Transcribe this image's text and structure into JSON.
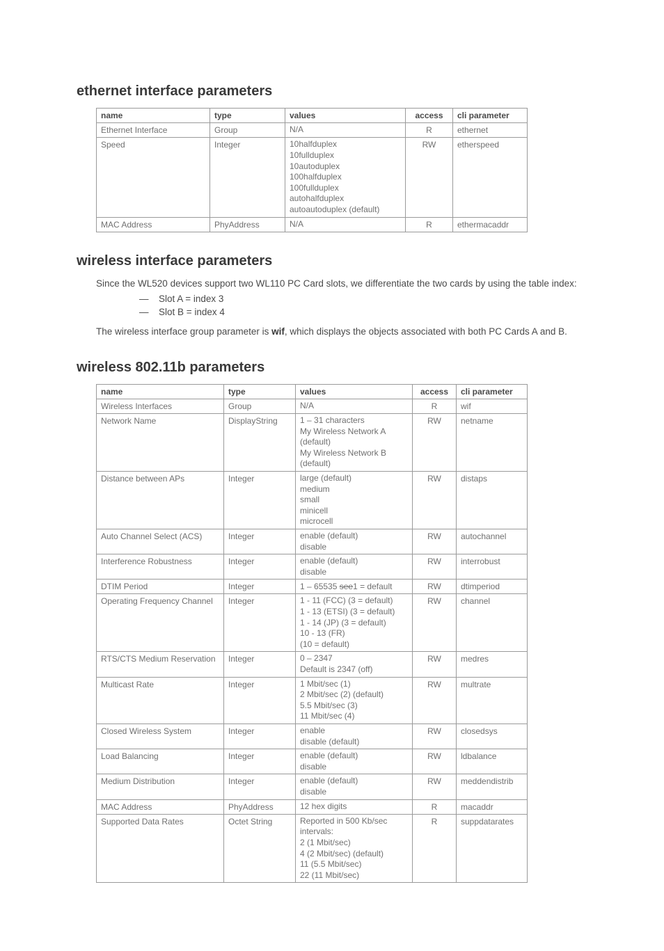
{
  "sections": {
    "ethernet": {
      "heading": "ethernet interface parameters",
      "cols": [
        "name",
        "type",
        "values",
        "access",
        "cli parameter"
      ],
      "rows": [
        {
          "name": "Ethernet Interface",
          "type": "Group",
          "values": [
            "N/A"
          ],
          "access": "R",
          "cli": "ethernet"
        },
        {
          "name": "Speed",
          "type": "Integer",
          "values": [
            "10halfduplex",
            "10fullduplex",
            "10autoduplex",
            "100halfduplex",
            "100fullduplex",
            "autohalfduplex",
            "autoautoduplex (default)"
          ],
          "access": "RW",
          "cli": "etherspeed"
        },
        {
          "name": "MAC Address",
          "type": "PhyAddress",
          "values": [
            "N/A"
          ],
          "access": "R",
          "cli": "ethermacaddr"
        }
      ]
    },
    "wireless_intro": {
      "heading": "wireless interface parameters",
      "p1": "Since the WL520 devices support two WL110 PC Card slots, we differentiate the two cards by using the table index:",
      "bullets": [
        "Slot A = index 3",
        "Slot B = index 4"
      ],
      "p2_pre": "The wireless interface group parameter is ",
      "p2_bold": "wif",
      "p2_post": ", which displays the objects associated with both PC Cards A and B."
    },
    "w80211b": {
      "heading": "wireless 802.11b parameters",
      "cols": [
        "name",
        "type",
        "values",
        "access",
        "cli parameter"
      ],
      "rows": [
        {
          "name": "Wireless Interfaces",
          "type": "Group",
          "values": [
            "N/A"
          ],
          "access": "R",
          "cli": "wif"
        },
        {
          "name": "Network Name",
          "type": "DisplayString",
          "values": [
            "1 – 31 characters",
            "My Wireless Network A (default)",
            "My Wireless Network B (default)"
          ],
          "access": "RW",
          "cli": "netname"
        },
        {
          "name": "Distance between APs",
          "type": "Integer",
          "values": [
            "large (default)",
            "medium",
            "small",
            "minicell",
            "microcell"
          ],
          "access": "RW",
          "cli": "distaps"
        },
        {
          "name": "Auto Channel Select (ACS)",
          "type": "Integer",
          "values": [
            "enable (default)",
            "disable"
          ],
          "access": "RW",
          "cli": "autochannel"
        },
        {
          "name": "Interference Robustness",
          "type": "Integer",
          "values": [
            "enable (default)",
            "disable"
          ],
          "access": "RW",
          "cli": "interrobust"
        },
        {
          "name": "DTIM Period",
          "type": "Integer",
          "values_html": "1 – 65535 <span class=\"strike\">see</span>1 = default",
          "access": "RW",
          "cli": "dtimperiod"
        },
        {
          "name": "Operating Frequency Channel",
          "type": "Integer",
          "values": [
            "1 - 11 (FCC) (3 = default)",
            "1 - 13 (ETSI) (3 = default)",
            "1 - 14 (JP) (3 = default)",
            "10 - 13 (FR)",
            "(10 = default)"
          ],
          "access": "RW",
          "cli": "channel"
        },
        {
          "name": "RTS/CTS Medium Reservation",
          "type": "Integer",
          "values": [
            "0 – 2347",
            "Default is 2347 (off)"
          ],
          "access": "RW",
          "cli": "medres"
        },
        {
          "name": "Multicast Rate",
          "type": "Integer",
          "values": [
            "1 Mbit/sec (1)",
            "2 Mbit/sec (2) (default)",
            "5.5 Mbit/sec (3)",
            "11 Mbit/sec (4)"
          ],
          "access": "RW",
          "cli": "multrate"
        },
        {
          "name": "Closed Wireless System",
          "type": "Integer",
          "values": [
            "enable",
            "disable (default)"
          ],
          "access": "RW",
          "cli": "closedsys"
        },
        {
          "name": "Load Balancing",
          "type": "Integer",
          "values": [
            "enable (default)",
            "disable"
          ],
          "access": "RW",
          "cli": "ldbalance"
        },
        {
          "name": "Medium Distribution",
          "type": "Integer",
          "values": [
            "enable (default)",
            "disable"
          ],
          "access": "RW",
          "cli": "meddendistrib"
        },
        {
          "name": "MAC Address",
          "type": "PhyAddress",
          "values": [
            "12 hex digits"
          ],
          "access": "R",
          "cli": "macaddr"
        },
        {
          "name": "Supported Data Rates",
          "type": "Octet String",
          "values": [
            "Reported in 500 Kb/sec intervals:",
            "2 (1 Mbit/sec)",
            "4 (2 Mbit/sec) (default)",
            "11 (5.5 Mbit/sec)",
            "22 (11 Mbit/sec)"
          ],
          "access": "R",
          "cli": "suppdatarates"
        }
      ]
    }
  },
  "chart_data": {
    "type": "table",
    "tables": [
      {
        "title": "ethernet interface parameters",
        "columns": [
          "name",
          "type",
          "values",
          "access",
          "cli parameter"
        ],
        "rows": [
          [
            "Ethernet Interface",
            "Group",
            "N/A",
            "R",
            "ethernet"
          ],
          [
            "Speed",
            "Integer",
            "10halfduplex; 10fullduplex; 10autoduplex; 100halfduplex; 100fullduplex; autohalfduplex; autoautoduplex (default)",
            "RW",
            "etherspeed"
          ],
          [
            "MAC Address",
            "PhyAddress",
            "N/A",
            "R",
            "ethermacaddr"
          ]
        ]
      },
      {
        "title": "wireless 802.11b parameters",
        "columns": [
          "name",
          "type",
          "values",
          "access",
          "cli parameter"
        ],
        "rows": [
          [
            "Wireless Interfaces",
            "Group",
            "N/A",
            "R",
            "wif"
          ],
          [
            "Network Name",
            "DisplayString",
            "1 – 31 characters; My Wireless Network A (default); My Wireless Network B (default)",
            "RW",
            "netname"
          ],
          [
            "Distance between APs",
            "Integer",
            "large (default); medium; small; minicell; microcell",
            "RW",
            "distaps"
          ],
          [
            "Auto Channel Select (ACS)",
            "Integer",
            "enable (default); disable",
            "RW",
            "autochannel"
          ],
          [
            "Interference Robustness",
            "Integer",
            "enable (default); disable",
            "RW",
            "interrobust"
          ],
          [
            "DTIM Period",
            "Integer",
            "1 – 65535 see 1 = default",
            "RW",
            "dtimperiod"
          ],
          [
            "Operating Frequency Channel",
            "Integer",
            "1 - 11 (FCC) (3 = default); 1 - 13 (ETSI) (3 = default); 1 - 14 (JP) (3 = default); 10 - 13 (FR); (10 = default)",
            "RW",
            "channel"
          ],
          [
            "RTS/CTS Medium Reservation",
            "Integer",
            "0 – 2347; Default is 2347 (off)",
            "RW",
            "medres"
          ],
          [
            "Multicast Rate",
            "Integer",
            "1 Mbit/sec (1); 2 Mbit/sec (2) (default); 5.5 Mbit/sec (3); 11 Mbit/sec (4)",
            "RW",
            "multrate"
          ],
          [
            "Closed Wireless System",
            "Integer",
            "enable; disable (default)",
            "RW",
            "closedsys"
          ],
          [
            "Load Balancing",
            "Integer",
            "enable (default); disable",
            "RW",
            "ldbalance"
          ],
          [
            "Medium Distribution",
            "Integer",
            "enable (default); disable",
            "RW",
            "meddendistrib"
          ],
          [
            "MAC Address",
            "PhyAddress",
            "12 hex digits",
            "R",
            "macaddr"
          ],
          [
            "Supported Data Rates",
            "Octet String",
            "Reported in 500 Kb/sec intervals:; 2 (1 Mbit/sec); 4 (2 Mbit/sec) (default); 11 (5.5 Mbit/sec); 22 (11 Mbit/sec)",
            "R",
            "suppdatarates"
          ]
        ]
      }
    ]
  }
}
